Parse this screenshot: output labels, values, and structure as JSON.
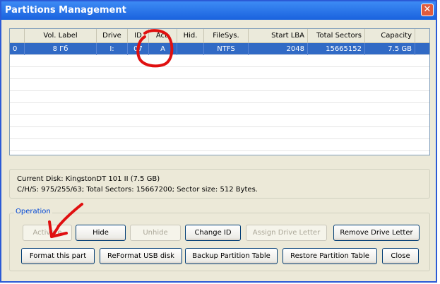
{
  "window": {
    "title": "Partitions Management",
    "close_symbol": "✕"
  },
  "table": {
    "headers": [
      "",
      "Vol. Label",
      "Drive",
      "ID",
      "Act.",
      "Hid.",
      "FileSys.",
      "Start LBA",
      "Total Sectors",
      "Capacity"
    ],
    "rows": [
      [
        "0",
        "8 Гб",
        "I:",
        "07",
        "A",
        "",
        "NTFS",
        "2048",
        "15665152",
        "7.5 GB"
      ]
    ],
    "selected_row": 0
  },
  "disk_info": {
    "line1": "Current Disk:  KingstonDT 101 II (7.5 GB)",
    "line2": "C/H/S: 975/255/63; Total Sectors: 15667200; Sector size: 512 Bytes."
  },
  "operation": {
    "legend": "Operation",
    "buttons": {
      "activate": "Activate",
      "hide": "Hide",
      "unhide": "Unhide",
      "change_id": "Change ID",
      "assign_drive_letter": "Assign Drive Letter",
      "remove_drive_letter": "Remove Drive Letter",
      "format_part": "Format this part",
      "reformat_usb": "ReFormat USB disk",
      "backup_table": "Backup Partition Table",
      "restore_table": "Restore Partition Table",
      "close": "Close"
    }
  },
  "colors": {
    "title_bar": "#1a62de",
    "selected_row": "#316ac5",
    "annotation": "#e01010"
  }
}
